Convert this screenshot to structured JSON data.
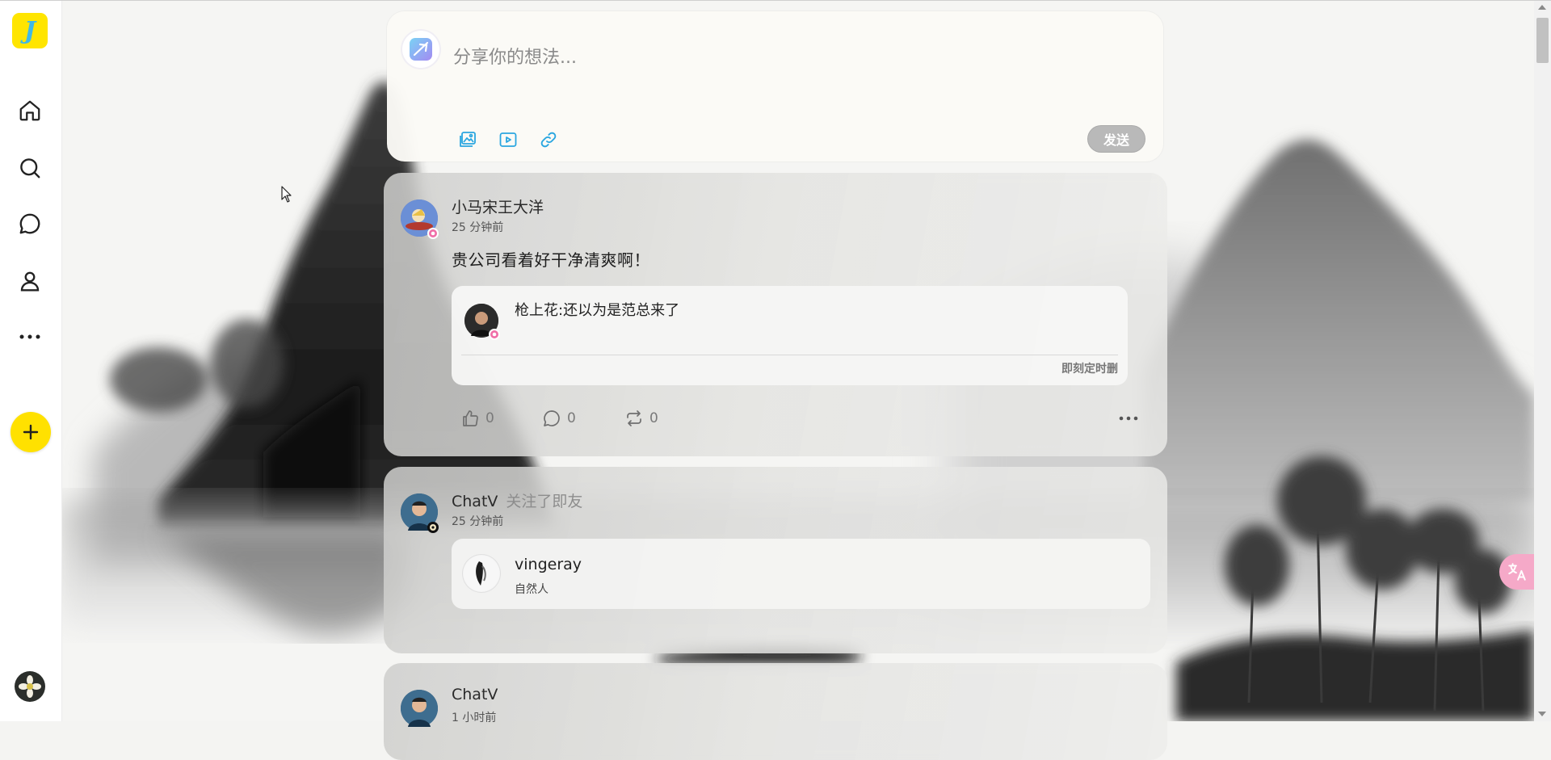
{
  "app": {
    "logo_letter": "J",
    "brand_color": "#ffe500"
  },
  "nav": [
    {
      "name": "home",
      "icon": "home-icon"
    },
    {
      "name": "search",
      "icon": "search-icon"
    },
    {
      "name": "messages",
      "icon": "chat-bubble-icon"
    },
    {
      "name": "profile",
      "icon": "user-icon"
    },
    {
      "name": "more",
      "icon": "more-horizontal-icon"
    }
  ],
  "composer": {
    "placeholder": "分享你的想法...",
    "send_label": "发送",
    "tools": [
      "image-icon",
      "video-icon",
      "link-icon"
    ]
  },
  "posts": [
    {
      "author": "小马宋王大洋",
      "time": "25 分钟前",
      "text": "贵公司看着好干净清爽啊！",
      "quote": {
        "text": "枪上花:还以为是范总来了",
        "footer": "即刻定时删"
      },
      "likes": "0",
      "comments": "0",
      "reposts": "0"
    },
    {
      "author": "ChatV",
      "action": "关注了即友",
      "time": "25 分钟前",
      "followed": {
        "name": "vingeray",
        "bio": "自然人"
      }
    },
    {
      "author": "ChatV",
      "time": "1 小时前"
    }
  ],
  "floating": {
    "translate_icon": "translate-icon",
    "translate_color": "#f5a9c8"
  }
}
